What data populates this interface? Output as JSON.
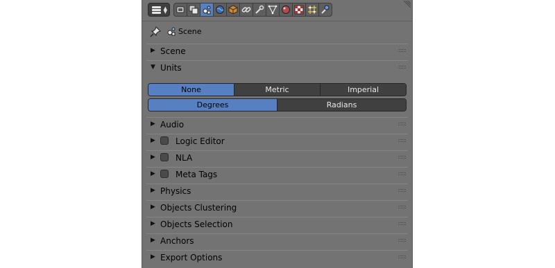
{
  "header": {
    "editor_type_icon": "properties-editor-icon",
    "tabs": [
      {
        "icon": "render-icon",
        "active": false
      },
      {
        "icon": "render-layers-icon",
        "active": false
      },
      {
        "icon": "scene-icon",
        "active": true
      },
      {
        "icon": "world-icon",
        "active": false
      },
      {
        "icon": "object-icon",
        "active": false
      },
      {
        "icon": "constraints-icon",
        "active": false
      },
      {
        "icon": "modifiers-icon",
        "active": false
      },
      {
        "icon": "data-icon",
        "active": false
      },
      {
        "icon": "material-icon",
        "active": false
      },
      {
        "icon": "texture-icon",
        "active": false
      },
      {
        "icon": "particles-icon",
        "active": false
      },
      {
        "icon": "physics-icon",
        "active": false
      }
    ]
  },
  "context": {
    "label": "Scene"
  },
  "panels": {
    "scene": {
      "title": "Scene",
      "expanded": false
    },
    "units": {
      "title": "Units",
      "expanded": true,
      "unit_system": {
        "options": [
          "None",
          "Metric",
          "Imperial"
        ],
        "selected": "None"
      },
      "rotation": {
        "options": [
          "Degrees",
          "Radians"
        ],
        "selected": "Degrees"
      }
    },
    "audio": {
      "title": "Audio",
      "expanded": false
    },
    "logic_editor": {
      "title": "Logic Editor",
      "expanded": false,
      "checkbox": false
    },
    "nla": {
      "title": "NLA",
      "expanded": false,
      "checkbox": false
    },
    "meta_tags": {
      "title": "Meta Tags",
      "expanded": false,
      "checkbox": false
    },
    "physics": {
      "title": "Physics",
      "expanded": false
    },
    "objects_clustering": {
      "title": "Objects Clustering",
      "expanded": false
    },
    "objects_selection": {
      "title": "Objects Selection",
      "expanded": false
    },
    "anchors": {
      "title": "Anchors",
      "expanded": false
    },
    "export_options": {
      "title": "Export Options",
      "expanded": false
    }
  },
  "colors": {
    "panel_bg": "#737373",
    "active_blue": "#5680c2",
    "button_dark": "#404040"
  }
}
